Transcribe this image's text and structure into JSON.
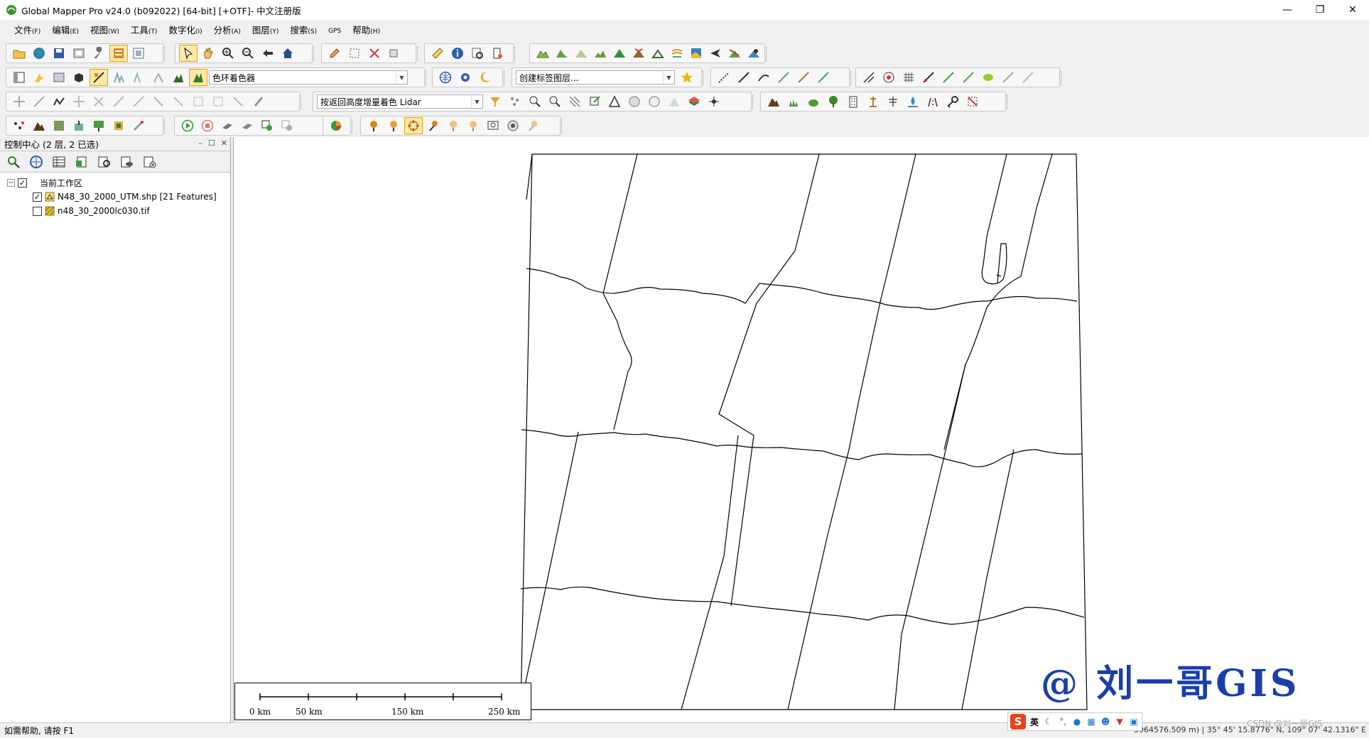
{
  "window": {
    "title": "Global Mapper Pro v24.0 (b092022) [64-bit] [+OTF]- 中文注册版",
    "minimize_glyph": "—",
    "maximize_glyph": "❐",
    "close_glyph": "✕"
  },
  "menu": [
    {
      "label": "文件",
      "key": "(F)"
    },
    {
      "label": "编辑",
      "key": "(E)"
    },
    {
      "label": "视图",
      "key": "(W)"
    },
    {
      "label": "工具",
      "key": "(T)"
    },
    {
      "label": "数字化",
      "key": "(I)"
    },
    {
      "label": "分析",
      "key": "(A)"
    },
    {
      "label": "图层",
      "key": "(Y)"
    },
    {
      "label": "搜索",
      "key": "(S)"
    },
    {
      "label": "GPS",
      "key": ""
    },
    {
      "label": "帮助",
      "key": "(H)"
    }
  ],
  "toolbars": {
    "shader_combo": "色环着色器",
    "label_layer_combo": "创建标签图层...",
    "lidar_combo": "按返回高度增量着色 Lidar"
  },
  "control_center": {
    "title": "控制中心 (2 层, 2 已选)",
    "pin_glyph": "–",
    "restore_glyph": "☐",
    "close_glyph": "✕",
    "workspace_label": "当前工作区",
    "layers": [
      {
        "name": "N48_30_2000_UTM.shp [21 Features]",
        "checked": true
      },
      {
        "name": "n48_30_2000lc030.tif",
        "checked": false
      }
    ]
  },
  "scale_bar": {
    "labels": [
      "0 km",
      "50 km",
      "150 km",
      "250 km"
    ]
  },
  "watermark": "@ 刘一哥GIS",
  "status": {
    "help_text": "如需帮助, 请按 F1",
    "coords": "3964576.509 m) | 35° 45' 15.8776\" N, 109° 07' 42.1316\" E"
  },
  "ime": {
    "logo": "S",
    "lang": "英"
  },
  "csdn": "CSDN @刘一哥GIS"
}
